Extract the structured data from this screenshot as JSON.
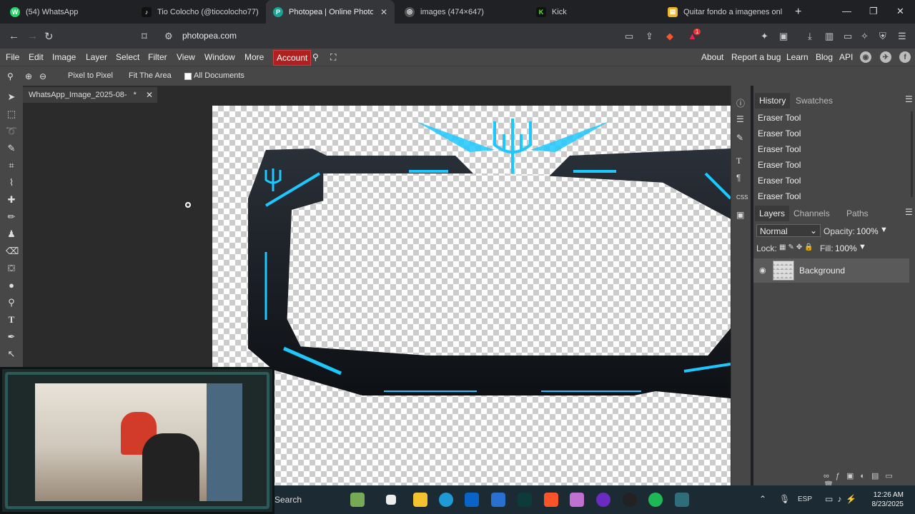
{
  "browser": {
    "tabs": [
      {
        "label": "(54) WhatsApp",
        "color": "#25d366",
        "glyph": "W"
      },
      {
        "label": "Tio Colocho (@tiocolocho77)",
        "color": "#111111",
        "glyph": "♪"
      },
      {
        "label": "Photopea | Online Photo Ed",
        "color": "#18a497",
        "glyph": "P"
      },
      {
        "label": "images (474×647)",
        "color": "#666666",
        "glyph": "◎"
      },
      {
        "label": "Kick",
        "color": "#53fc18",
        "glyph": "K"
      },
      {
        "label": "Quitar fondo a imagenes online",
        "color": "#f0b429",
        "glyph": "▤"
      }
    ],
    "active_tab_close": "✕",
    "new_tab": "+",
    "url": "photopea.com",
    "notification_badge": "1"
  },
  "menubar": {
    "items": [
      "File",
      "Edit",
      "Image",
      "Layer",
      "Select",
      "Filter",
      "View",
      "Window",
      "More"
    ],
    "account": "Account",
    "right_items": [
      "About",
      "Report a bug",
      "Learn",
      "Blog",
      "API"
    ]
  },
  "options": {
    "pixel_to_pixel": "Pixel to Pixel",
    "fit_the_area": "Fit The Area",
    "all_documents": "All Documents"
  },
  "document": {
    "tab_label": "WhatsApp_Image_2025-08-",
    "modified_marker": "*",
    "close": "✕"
  },
  "history": {
    "tab_history": "History",
    "tab_swatches": "Swatches",
    "items": [
      "Eraser Tool",
      "Eraser Tool",
      "Eraser Tool",
      "Eraser Tool",
      "Eraser Tool",
      "Eraser Tool"
    ]
  },
  "layers": {
    "tab_layers": "Layers",
    "tab_channels": "Channels",
    "tab_paths": "Paths",
    "blend_mode": "Normal",
    "opacity_label": "Opacity:",
    "opacity_value": "100%",
    "lock_label": "Lock:",
    "fill_label": "Fill:",
    "fill_value": "100%",
    "layer_name": "Background"
  },
  "taskbar": {
    "search": "Search",
    "language": "ESP",
    "time": "12:26 AM",
    "date": "8/23/2025"
  },
  "colors": {
    "accent_cyan": "#1ec8ff",
    "account_red": "#b02020"
  }
}
